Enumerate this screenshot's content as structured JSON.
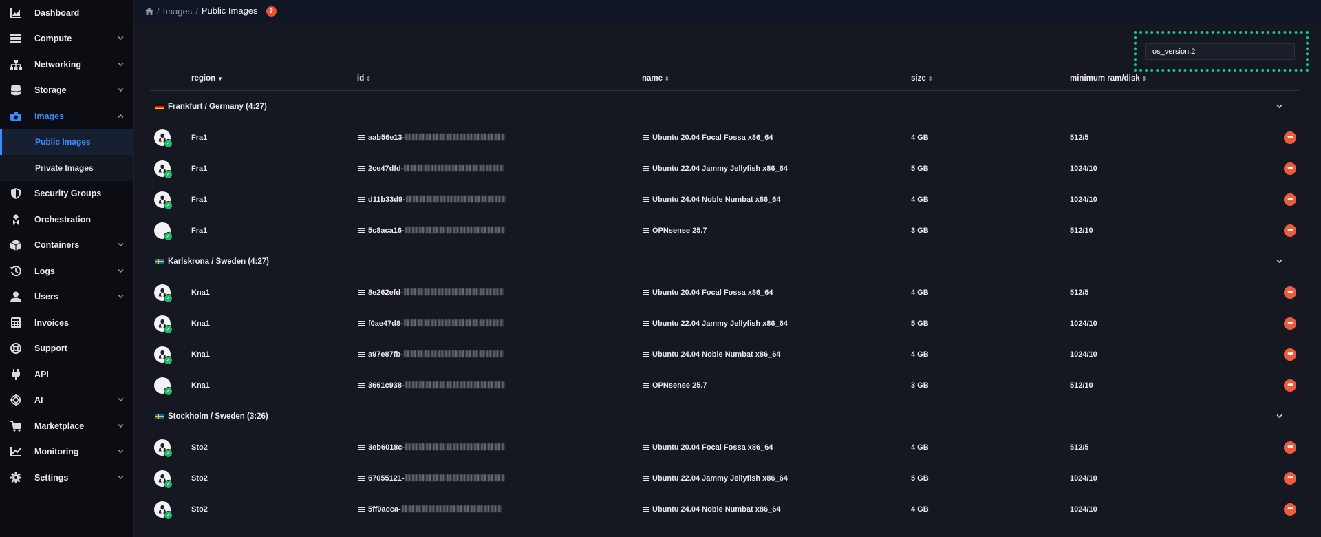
{
  "sidebar": {
    "items": [
      {
        "label": "Dashboard",
        "icon": "chart-area-icon",
        "chevron": false
      },
      {
        "label": "Compute",
        "icon": "server-icon",
        "chevron": true
      },
      {
        "label": "Networking",
        "icon": "network-icon",
        "chevron": true
      },
      {
        "label": "Storage",
        "icon": "database-icon",
        "chevron": true
      },
      {
        "label": "Images",
        "icon": "camera-icon",
        "chevron": true,
        "expanded": true
      },
      {
        "label": "Public Images",
        "sub": true,
        "selected": true
      },
      {
        "label": "Private Images",
        "sub": true
      },
      {
        "label": "Security Groups",
        "icon": "shield-icon",
        "chevron": false
      },
      {
        "label": "Orchestration",
        "icon": "orchestration-icon",
        "chevron": false
      },
      {
        "label": "Containers",
        "icon": "box-icon",
        "chevron": true
      },
      {
        "label": "Logs",
        "icon": "history-icon",
        "chevron": true
      },
      {
        "label": "Users",
        "icon": "user-icon",
        "chevron": true
      },
      {
        "label": "Invoices",
        "icon": "calculator-icon",
        "chevron": false
      },
      {
        "label": "Support",
        "icon": "lifebuoy-icon",
        "chevron": false
      },
      {
        "label": "API",
        "icon": "plug-icon",
        "chevron": false
      },
      {
        "label": "AI",
        "icon": "ai-icon",
        "chevron": true
      },
      {
        "label": "Marketplace",
        "icon": "cart-icon",
        "chevron": true
      },
      {
        "label": "Monitoring",
        "icon": "chart-line-icon",
        "chevron": true
      },
      {
        "label": "Settings",
        "icon": "gear-icon",
        "chevron": true
      }
    ]
  },
  "breadcrumb": {
    "home_icon": "home-icon",
    "parent": "Images",
    "current": "Public Images",
    "separator": "/"
  },
  "search": {
    "value": "os_version:2"
  },
  "table": {
    "columns": {
      "region": "region",
      "id": "id",
      "name": "name",
      "size": "size",
      "min": "minimum ram/disk"
    },
    "groups": [
      {
        "label": "Frankfurt / Germany (4:27)",
        "flag": "de",
        "rows": [
          {
            "region": "Fra1",
            "id": "aab56e13-",
            "name": "Ubuntu 20.04 Focal Fossa x86_64",
            "size": "4 GB",
            "min": "512/5",
            "os": "linux"
          },
          {
            "region": "Fra1",
            "id": "2ce47dfd-",
            "name": "Ubuntu 22.04 Jammy Jellyfish x86_64",
            "size": "5 GB",
            "min": "1024/10",
            "os": "linux"
          },
          {
            "region": "Fra1",
            "id": "d11b33d9-",
            "name": "Ubuntu 24.04 Noble Numbat x86_64",
            "size": "4 GB",
            "min": "1024/10",
            "os": "linux"
          },
          {
            "region": "Fra1",
            "id": "5c8aca16-",
            "name": "OPNsense 25.7",
            "size": "3 GB",
            "min": "512/10",
            "os": "opnsense"
          }
        ]
      },
      {
        "label": "Karlskrona / Sweden (4:27)",
        "flag": "se",
        "rows": [
          {
            "region": "Kna1",
            "id": "8e262efd-",
            "name": "Ubuntu 20.04 Focal Fossa x86_64",
            "size": "4 GB",
            "min": "512/5",
            "os": "linux"
          },
          {
            "region": "Kna1",
            "id": "f0ae47d8-",
            "name": "Ubuntu 22.04 Jammy Jellyfish x86_64",
            "size": "5 GB",
            "min": "1024/10",
            "os": "linux"
          },
          {
            "region": "Kna1",
            "id": "a97e87fb-",
            "name": "Ubuntu 24.04 Noble Numbat x86_64",
            "size": "4 GB",
            "min": "1024/10",
            "os": "linux"
          },
          {
            "region": "Kna1",
            "id": "3661c938-",
            "name": "OPNsense 25.7",
            "size": "3 GB",
            "min": "512/10",
            "os": "opnsense"
          }
        ]
      },
      {
        "label": "Stockholm / Sweden (3:26)",
        "flag": "se",
        "rows": [
          {
            "region": "Sto2",
            "id": "3eb6018c-",
            "name": "Ubuntu 20.04 Focal Fossa x86_64",
            "size": "4 GB",
            "min": "512/5",
            "os": "linux"
          },
          {
            "region": "Sto2",
            "id": "67055121-",
            "name": "Ubuntu 22.04 Jammy Jellyfish x86_64",
            "size": "5 GB",
            "min": "1024/10",
            "os": "linux"
          },
          {
            "region": "Sto2",
            "id": "5ff0acca-",
            "name": "Ubuntu 24.04 Noble Numbat x86_64",
            "size": "4 GB",
            "min": "1024/10",
            "os": "linux"
          }
        ]
      }
    ]
  },
  "colors": {
    "accent": "#3e8bff",
    "action": "#f05a3c",
    "highlight": "#19c49b",
    "status_ok": "#27b86b"
  }
}
